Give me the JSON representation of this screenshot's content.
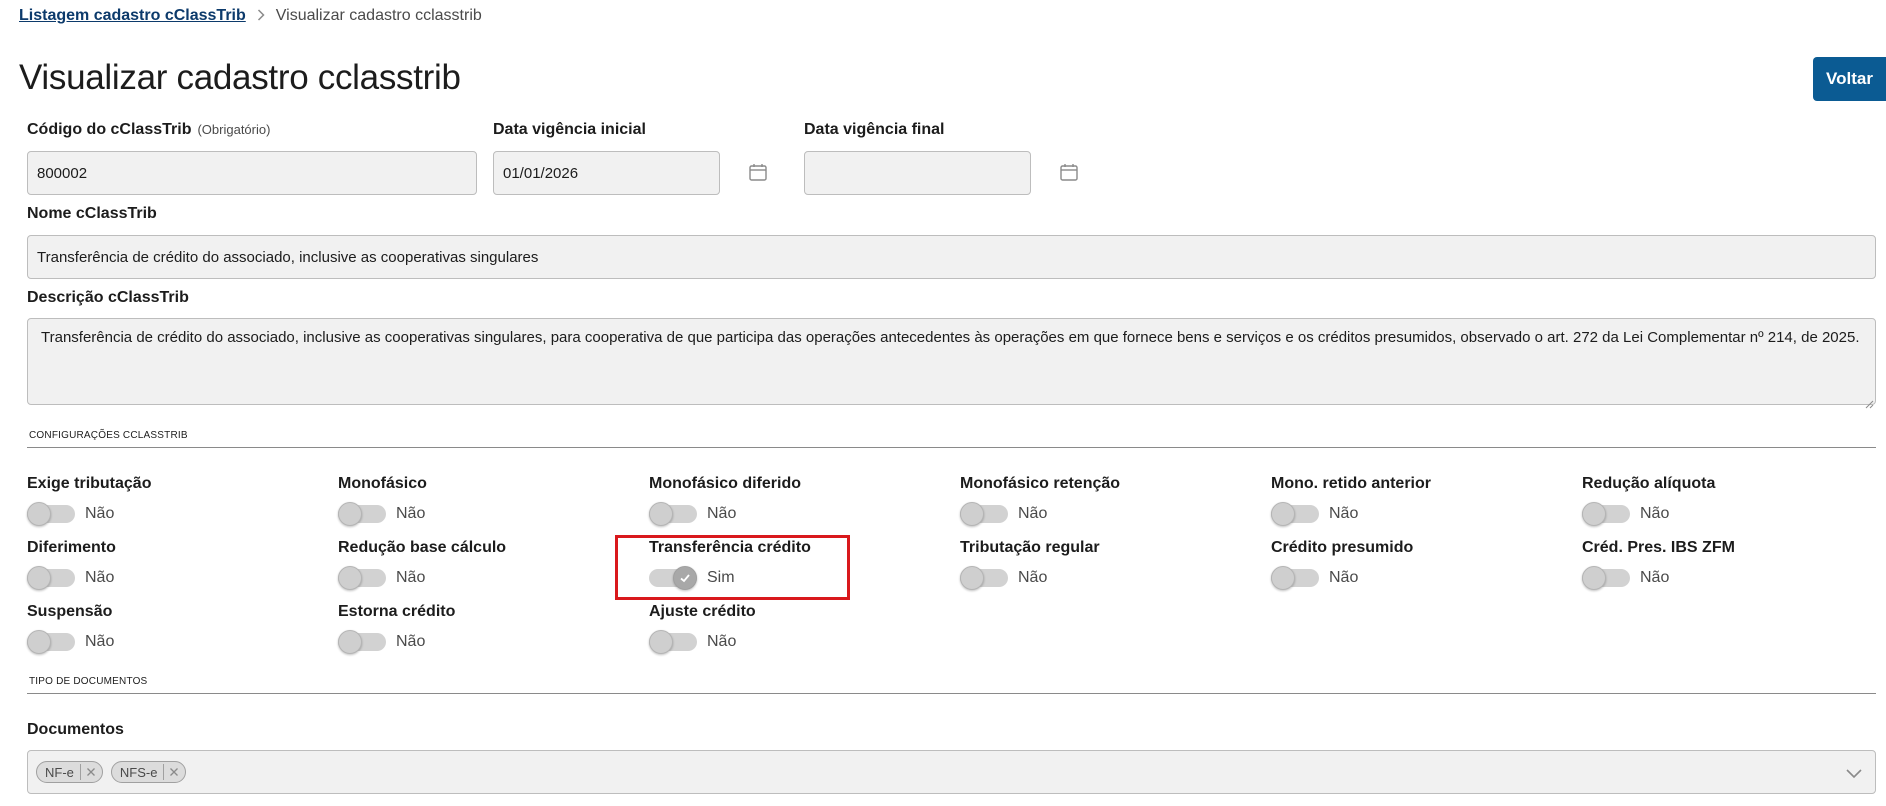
{
  "breadcrumb": {
    "parent": "Listagem cadastro cClassTrib",
    "current": "Visualizar cadastro cclasstrib"
  },
  "page_title": "Visualizar cadastro cclasstrib",
  "actions": {
    "back_label": "Voltar"
  },
  "form": {
    "codigo": {
      "label": "Código do cClassTrib",
      "hint": "(Obrigatório)",
      "value": "800002"
    },
    "data_inicial": {
      "label": "Data vigência inicial",
      "value": "01/01/2026"
    },
    "data_final": {
      "label": "Data vigência final",
      "value": ""
    },
    "nome": {
      "label": "Nome cClassTrib",
      "value": "Transferência de crédito do associado, inclusive as cooperativas singulares"
    },
    "descricao": {
      "label": "Descrição cClassTrib",
      "value": "Transferência de crédito do associado, inclusive as cooperativas singulares, para cooperativa de que participa das operações antecedentes às operações em que fornece bens e serviços e os créditos presumidos, observado o art. 272 da Lei Complementar nº 214, de 2025."
    }
  },
  "config_section": {
    "title": "CONFIGURAÇÕES CCLASSTRIB",
    "switches": [
      {
        "label": "Exige tributação",
        "value": "Não",
        "on": false
      },
      {
        "label": "Monofásico",
        "value": "Não",
        "on": false
      },
      {
        "label": "Monofásico diferido",
        "value": "Não",
        "on": false
      },
      {
        "label": "Monofásico retenção",
        "value": "Não",
        "on": false
      },
      {
        "label": "Mono. retido anterior",
        "value": "Não",
        "on": false
      },
      {
        "label": "Redução alíquota",
        "value": "Não",
        "on": false
      },
      {
        "label": "Diferimento",
        "value": "Não",
        "on": false
      },
      {
        "label": "Redução base cálculo",
        "value": "Não",
        "on": false
      },
      {
        "label": "Transferência crédito",
        "value": "Sim",
        "on": true
      },
      {
        "label": "Tributação regular",
        "value": "Não",
        "on": false
      },
      {
        "label": "Crédito presumido",
        "value": "Não",
        "on": false
      },
      {
        "label": "Créd. Pres. IBS ZFM",
        "value": "Não",
        "on": false
      },
      {
        "label": "Suspensão",
        "value": "Não",
        "on": false
      },
      {
        "label": "Estorna crédito",
        "value": "Não",
        "on": false
      },
      {
        "label": "Ajuste crédito",
        "value": "Não",
        "on": false
      }
    ]
  },
  "docs_section": {
    "title": "TIPO DE DOCUMENTOS",
    "label": "Documentos",
    "chips": [
      "NF-e",
      "NFS-e"
    ]
  },
  "colors": {
    "primary": "#0b5b93",
    "breadcrumb_link": "#0c3a6b",
    "highlight": "#d9181c",
    "field_bg": "#f1f1f1"
  }
}
